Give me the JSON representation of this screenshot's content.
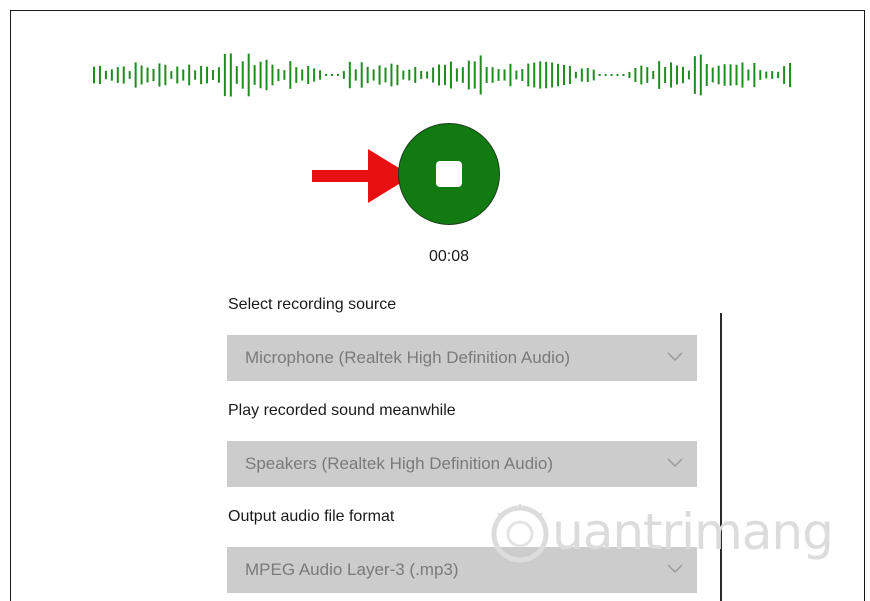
{
  "colors": {
    "waveform": "#1e8c1e",
    "record_button": "#117a11",
    "arrow": "#e81010",
    "dropdown_bg": "#cccccc",
    "dropdown_text": "#7a7a7a"
  },
  "recorder": {
    "elapsed_time": "00:08",
    "button_icon": "stop-icon"
  },
  "settings": {
    "source_label": "Select recording source",
    "source_value": "Microphone (Realtek High Definition Audio)",
    "playback_label": "Play recorded sound meanwhile",
    "playback_value": "Speakers (Realtek High Definition Audio)",
    "format_label": "Output audio file format",
    "format_value": "MPEG Audio Layer-3 (.mp3)"
  },
  "watermark": {
    "text": "uantrimang",
    "icon": "quantrimang-logo-icon"
  }
}
